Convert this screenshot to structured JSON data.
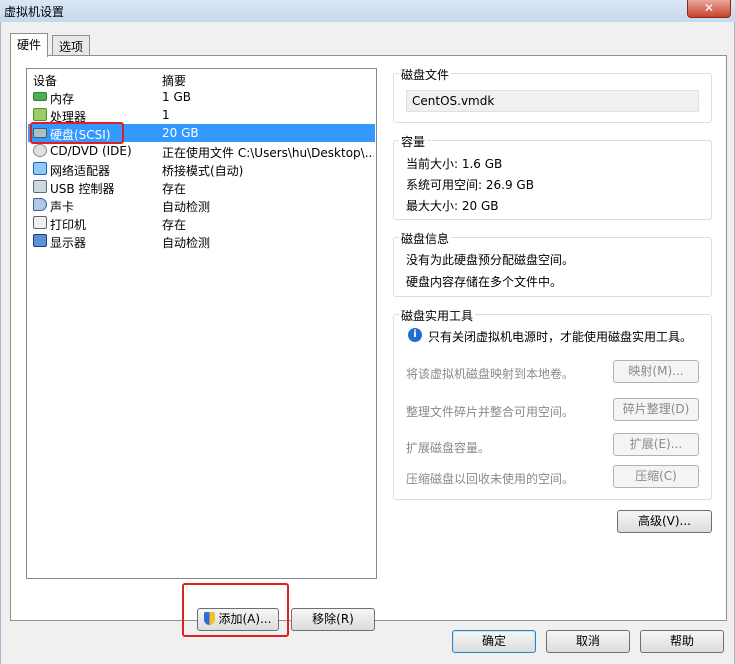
{
  "window": {
    "title": "虚拟机设置",
    "close": "✕"
  },
  "tabs": [
    {
      "label": "硬件"
    },
    {
      "label": "选项"
    }
  ],
  "devices": {
    "col_device": "设备",
    "col_summary": "摘要",
    "rows": [
      {
        "name": "内存",
        "summary": "1 GB"
      },
      {
        "name": "处理器",
        "summary": "1"
      },
      {
        "name": "硬盘(SCSI)",
        "summary": "20 GB"
      },
      {
        "name": "CD/DVD (IDE)",
        "summary": "正在使用文件 C:\\Users\\hu\\Desktop\\..."
      },
      {
        "name": "网络适配器",
        "summary": "桥接模式(自动)"
      },
      {
        "name": "USB 控制器",
        "summary": "存在"
      },
      {
        "name": "声卡",
        "summary": "自动检测"
      },
      {
        "name": "打印机",
        "summary": "存在"
      },
      {
        "name": "显示器",
        "summary": "自动检测"
      }
    ],
    "add_label": "添加(A)...",
    "remove_label": "移除(R)"
  },
  "disk_file": {
    "title": "磁盘文件",
    "value": "CentOS.vmdk"
  },
  "capacity": {
    "title": "容量",
    "current": "当前大小: 1.6 GB",
    "available": "系统可用空间: 26.9 GB",
    "max": "最大大小: 20 GB"
  },
  "disk_info": {
    "title": "磁盘信息",
    "line1": "没有为此硬盘预分配磁盘空间。",
    "line2": "硬盘内容存储在多个文件中。"
  },
  "utilities": {
    "title": "磁盘实用工具",
    "note": "只有关闭虚拟机电源时，才能使用磁盘实用工具。",
    "map_desc": "将该虚拟机磁盘映射到本地卷。",
    "map_btn": "映射(M)...",
    "defrag_desc": "整理文件碎片并整合可用空间。",
    "defrag_btn": "碎片整理(D)",
    "expand_desc": "扩展磁盘容量。",
    "expand_btn": "扩展(E)...",
    "compact_desc": "压缩磁盘以回收未使用的空间。",
    "compact_btn": "压缩(C)"
  },
  "advanced_label": "高级(V)...",
  "footer": {
    "ok": "确定",
    "cancel": "取消",
    "help": "帮助"
  }
}
